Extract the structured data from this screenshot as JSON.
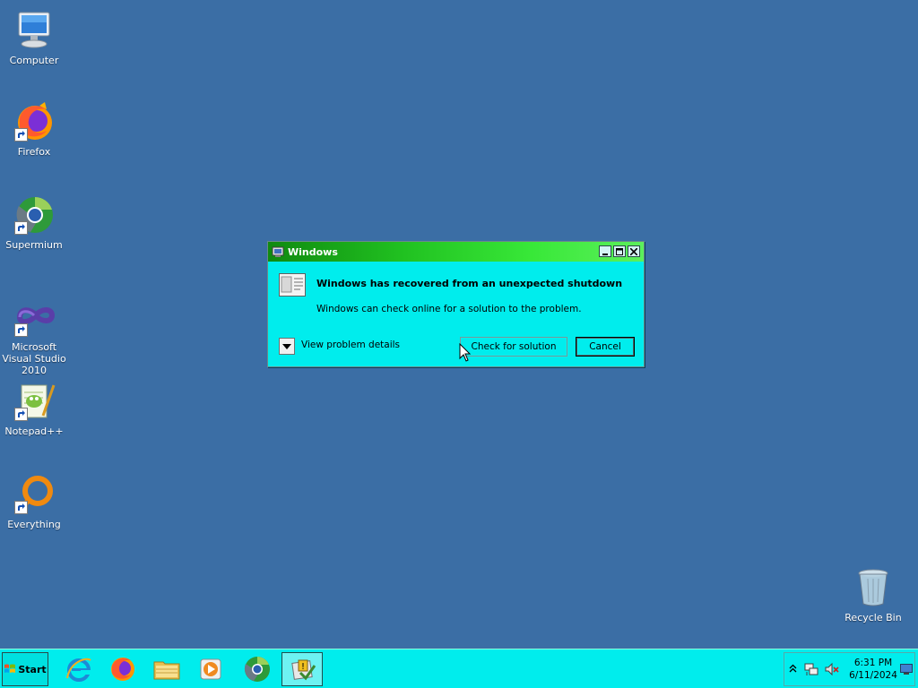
{
  "desktop": {
    "icons": [
      {
        "label": "Computer"
      },
      {
        "label": "Firefox"
      },
      {
        "label": "Supermium"
      },
      {
        "label": "Microsoft Visual Studio 2010"
      },
      {
        "label": "Notepad++"
      },
      {
        "label": "Everything"
      },
      {
        "label": "Recycle Bin"
      }
    ]
  },
  "dialog": {
    "title": "Windows",
    "heading": "Windows has recovered from an unexpected shutdown",
    "message": "Windows can check online for a solution to the problem.",
    "details_label": "View problem details",
    "check_button": "Check for solution",
    "cancel_button": "Cancel"
  },
  "taskbar": {
    "start_label": "Start",
    "apps": [
      "internet-explorer",
      "firefox",
      "file-explorer",
      "media-player",
      "supermium",
      "active-window"
    ],
    "clock": {
      "time": "6:31 PM",
      "date": "6/11/2024"
    }
  },
  "colors": {
    "desktop": "#3b6ea5",
    "window_face": "#00eded",
    "titlebar": "#20c020"
  }
}
